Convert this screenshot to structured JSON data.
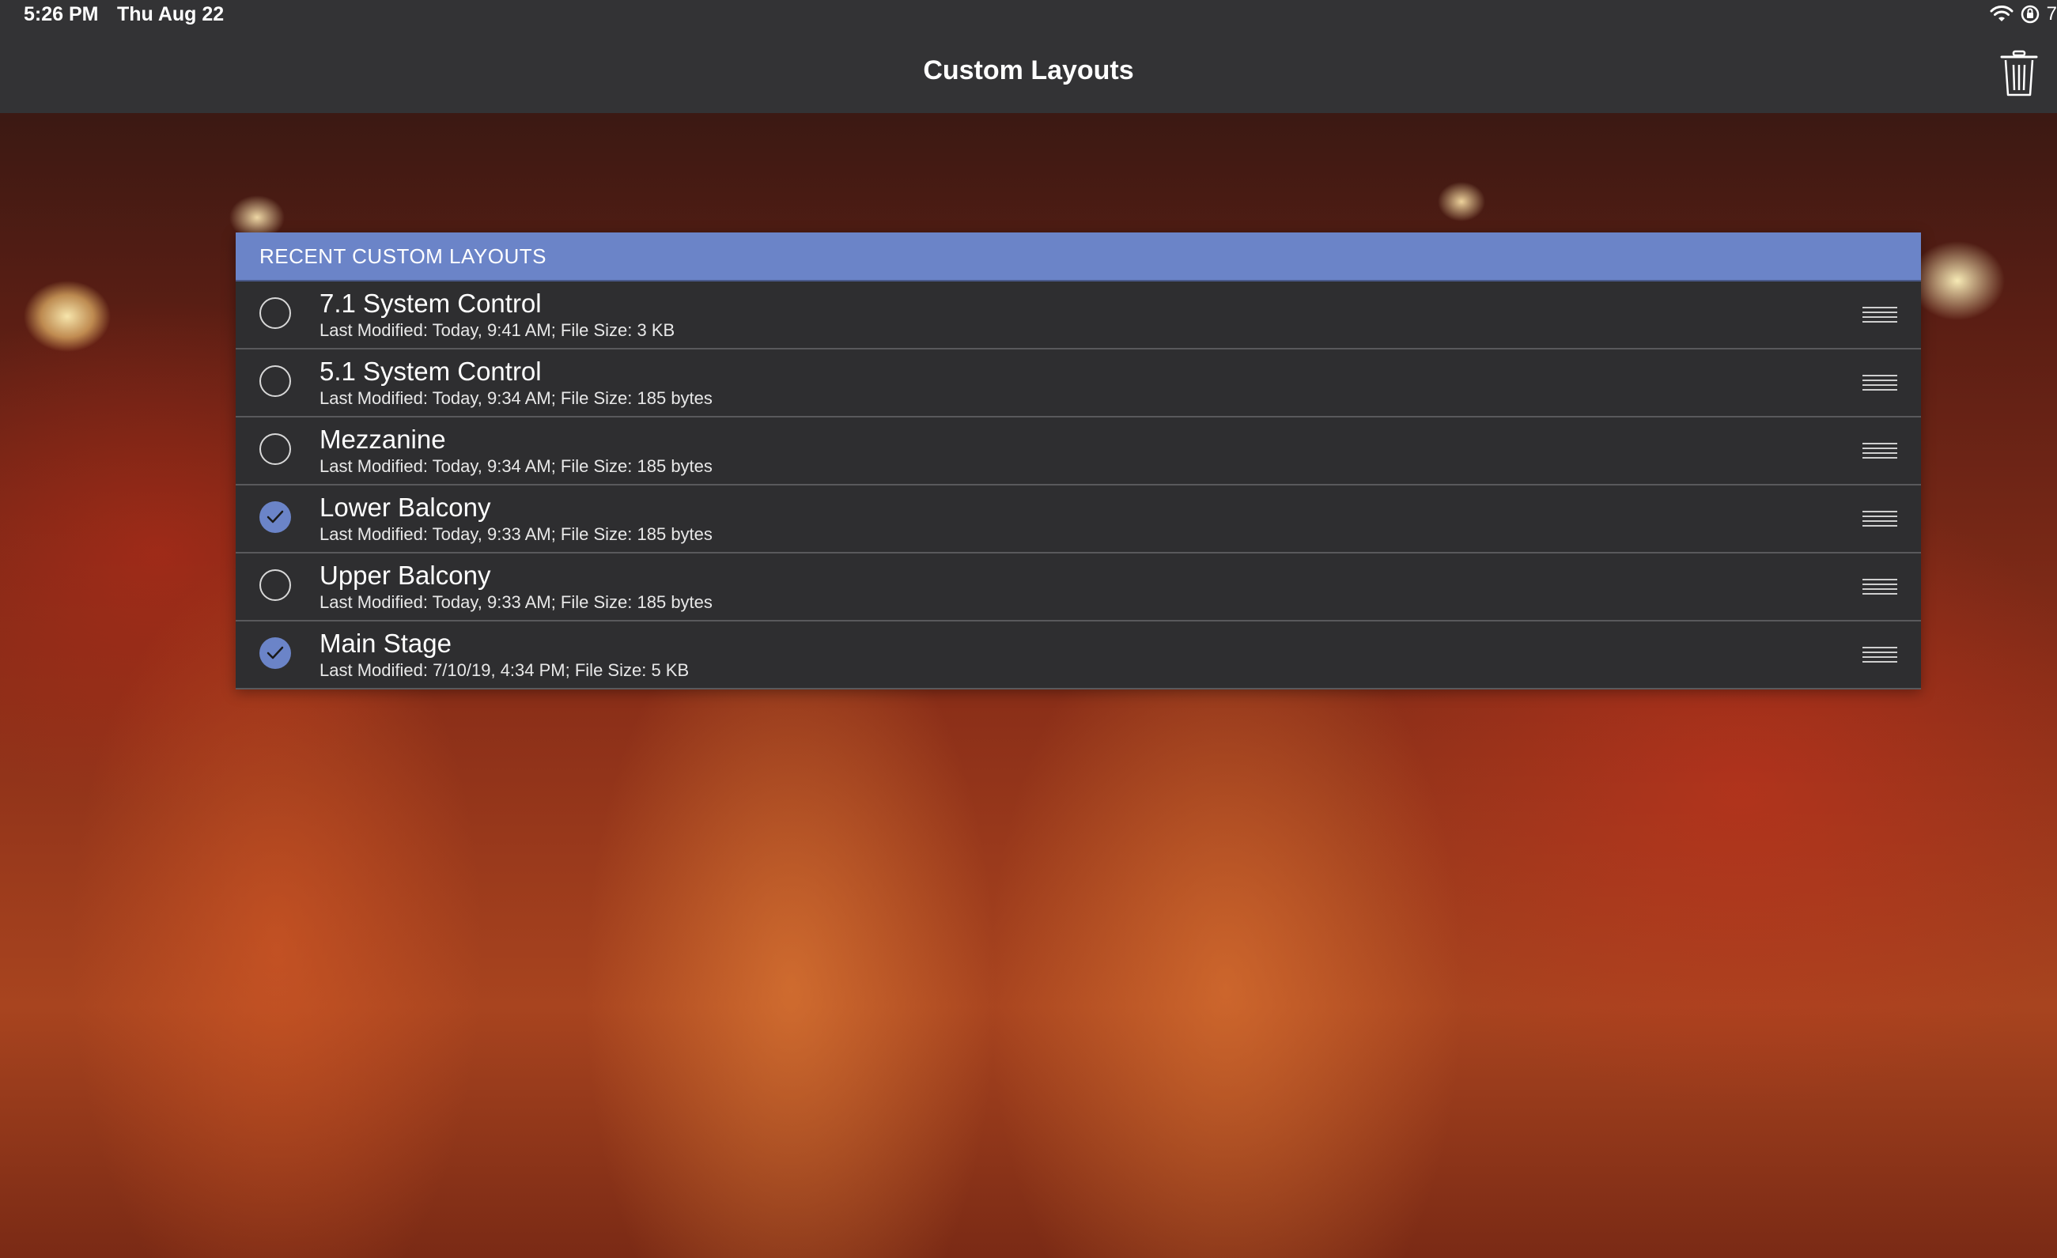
{
  "status_bar": {
    "time": "5:26 PM",
    "date": "Thu Aug 22",
    "battery_text": "7"
  },
  "nav": {
    "title": "Custom Layouts",
    "trash_icon": "trash-icon"
  },
  "section": {
    "header": "RECENT CUSTOM LAYOUTS"
  },
  "accent_color": "#6b84c8",
  "layouts": [
    {
      "name": "7.1 System Control",
      "details": "Last Modified: Today, 9:41 AM; File Size: 3 KB",
      "checked": false
    },
    {
      "name": "5.1 System Control",
      "details": "Last Modified: Today, 9:34 AM; File Size: 185 bytes",
      "checked": false
    },
    {
      "name": "Mezzanine",
      "details": "Last Modified: Today, 9:34 AM; File Size: 185 bytes",
      "checked": false
    },
    {
      "name": "Lower Balcony",
      "details": "Last Modified: Today, 9:33 AM; File Size: 185 bytes",
      "checked": true
    },
    {
      "name": "Upper Balcony",
      "details": "Last Modified: Today, 9:33 AM; File Size: 185 bytes",
      "checked": false
    },
    {
      "name": "Main Stage",
      "details": "Last Modified: 7/10/19, 4:34 PM; File Size: 5 KB",
      "checked": true
    }
  ]
}
